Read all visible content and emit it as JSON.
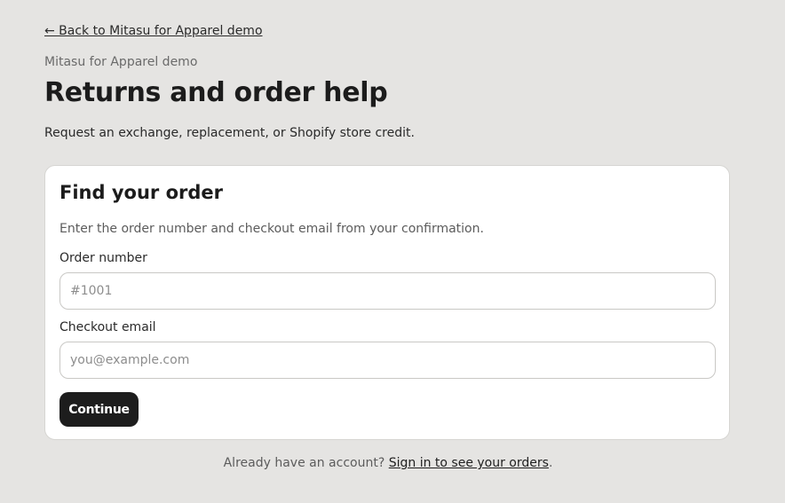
{
  "header": {
    "back_link": "← Back to Mitasu for Apparel demo",
    "shop_name": "Mitasu for Apparel demo",
    "title": "Returns and order help",
    "subtitle": "Request an exchange, replacement, or Shopify store credit."
  },
  "form": {
    "title": "Find your order",
    "description": "Enter the order number and checkout email from your confirmation.",
    "order_number": {
      "label": "Order number",
      "placeholder": "#1001",
      "value": ""
    },
    "checkout_email": {
      "label": "Checkout email",
      "placeholder": "you@example.com",
      "value": ""
    },
    "submit_label": "Continue"
  },
  "footer": {
    "prefix": "Already have an account?",
    "link": "Sign in to see your orders",
    "suffix": "."
  }
}
